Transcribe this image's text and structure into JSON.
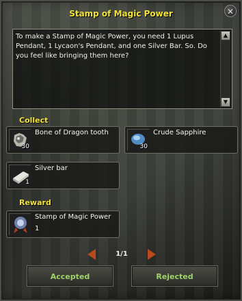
{
  "window": {
    "title": "Stamp of Magic Power",
    "close_icon": "close-icon"
  },
  "dialog": {
    "text": "To make a Stamp of Magic Power, you need 1 Lupus Pendant,  1 Lycaon's Pendant, and one Silver Bar. So. Do you feel like bringing them here?"
  },
  "collect": {
    "label": "Collect",
    "items": [
      {
        "name": "Bone of Dragon tooth",
        "count": "30",
        "icon": "dragon-tooth-icon"
      },
      {
        "name": "Crude Sapphire",
        "count": "30",
        "icon": "sapphire-icon"
      },
      {
        "name": "Silver bar",
        "count": "1",
        "icon": "silver-bar-icon"
      }
    ]
  },
  "reward": {
    "label": "Reward",
    "items": [
      {
        "name": "Stamp of Magic Power",
        "count": "1",
        "icon": "magic-stamp-icon"
      }
    ]
  },
  "pager": {
    "text": "1/1"
  },
  "buttons": {
    "accept_label": "Accepted",
    "reject_label": "Rejected"
  },
  "colors": {
    "title": "#f2e43a",
    "button_text": "#9ed36a",
    "pager_arrow": "#b84a1c"
  }
}
